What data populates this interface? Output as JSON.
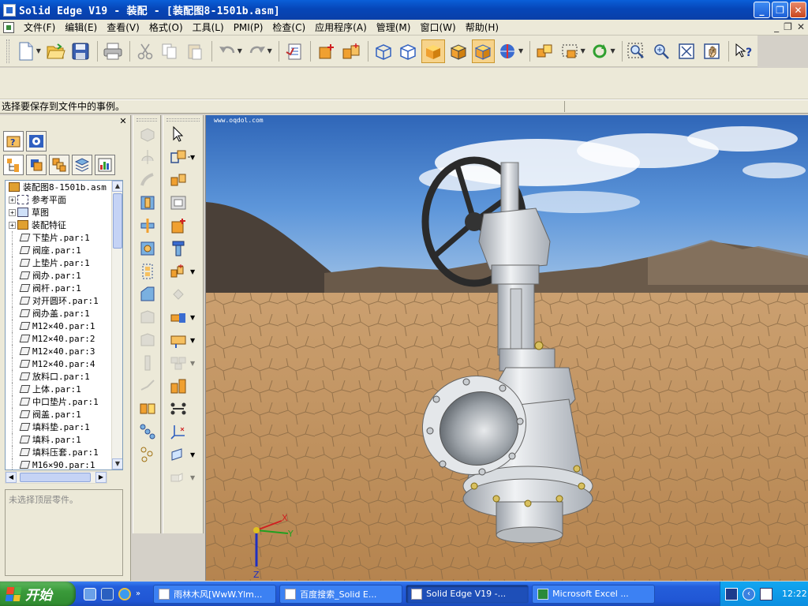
{
  "window": {
    "title": "Solid Edge V19 - 装配 - [装配图8-1501b.asm]",
    "min": "_",
    "max": "❐",
    "close": "✕"
  },
  "menu": {
    "items": [
      "文件(F)",
      "编辑(E)",
      "查看(V)",
      "格式(O)",
      "工具(L)",
      "PMI(P)",
      "检查(C)",
      "应用程序(A)",
      "管理(M)",
      "窗口(W)",
      "帮助(H)"
    ],
    "mdi_min": "_",
    "mdi_max": "❐",
    "mdi_close": "✕"
  },
  "prompt": {
    "text": "选择要保存到文件中的事例。"
  },
  "pathfinder": {
    "close": "✕",
    "root": "装配图8-1501b.asm",
    "groups": [
      "参考平面",
      "草图",
      "装配特征"
    ],
    "parts": [
      "下垫片.par:1",
      "阀座.par:1",
      "上垫片.par:1",
      "阀办.par:1",
      "阀杆.par:1",
      "对开圆环.par:1",
      "阀办盖.par:1",
      "M12×40.par:1",
      "M12×40.par:2",
      "M12×40.par:3",
      "M12×40.par:4",
      "放料口.par:1",
      "上体.par:1",
      "中口垫片.par:1",
      "阀盖.par:1",
      "填料垫.par:1",
      "填料.par:1",
      "填料压套.par:1",
      "M16×90.par:1"
    ],
    "status": "未选择顶层零件。"
  },
  "viewport": {
    "watermark": "www.oqdol.com",
    "axis_labels": [
      "X",
      "Y",
      "Z"
    ]
  },
  "taskbar": {
    "start": "开始",
    "buttons": [
      "雨林木风[WwW.Ylm...",
      "百度搜索_Solid E...",
      "Solid Edge V19 -...",
      "Microsoft Excel ..."
    ],
    "clock": "12:22"
  },
  "colors": {
    "title_bar": "#0a5fd8",
    "taskbar": "#245edb",
    "start_button": "#3a9a3a",
    "sky": "#3f7fcf",
    "ground": "#c79a63"
  }
}
